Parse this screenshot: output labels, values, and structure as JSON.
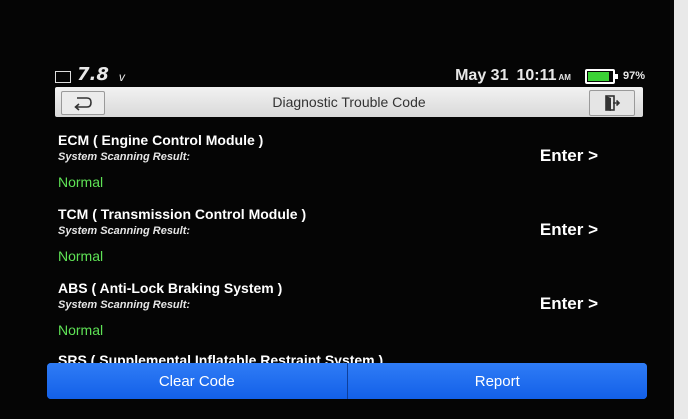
{
  "status": {
    "voltage": "7.8",
    "voltage_unit": "v",
    "date": "May 31",
    "time": "10:11",
    "ampm": "AM",
    "battery_percent": "97%",
    "battery_level": 0.97,
    "icons": [
      "battery-voltage-icon",
      "battery-icon"
    ]
  },
  "header": {
    "title": "Diagnostic Trouble Code",
    "back_icon": "back-arrow-icon",
    "exit_icon": "exit-door-icon"
  },
  "modules": [
    {
      "name": "ECM ( Engine Control Module )",
      "sublabel": "System Scanning Result:",
      "status": "Normal",
      "action": "Enter >"
    },
    {
      "name": "TCM ( Transmission Control Module )",
      "sublabel": "System Scanning Result:",
      "status": "Normal",
      "action": "Enter >"
    },
    {
      "name": "ABS ( Anti-Lock Braking System )",
      "sublabel": "System Scanning Result:",
      "status": "Normal",
      "action": "Enter >"
    }
  ],
  "partial_module": "SRS ( Supplemental Inflatable Restraint System )",
  "footer": {
    "clear_label": "Clear Code",
    "report_label": "Report"
  },
  "colors": {
    "accent": "#1c6ef2",
    "status_ok": "#5fe356",
    "battery": "#3bd236"
  }
}
